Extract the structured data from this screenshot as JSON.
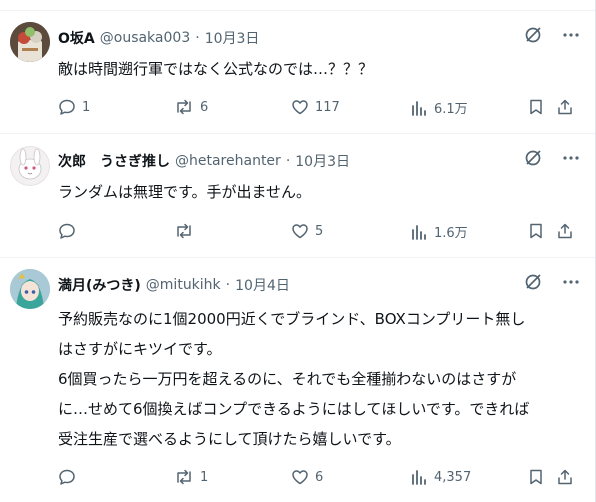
{
  "tweets": [
    {
      "name": "O坂A",
      "handle": "@ousaka003",
      "date": "10月3日",
      "lines": [
        "敵は時間遡行軍ではなく公式なのでは…？？？"
      ],
      "replies": "1",
      "reposts": "6",
      "likes": "117",
      "views": "6.1万"
    },
    {
      "name": "次郎　うさぎ推し",
      "handle": "@hetarehanter",
      "date": "10月3日",
      "lines": [
        "ランダムは無理です。手が出ません。"
      ],
      "replies": "",
      "reposts": "",
      "likes": "5",
      "views": "1.6万"
    },
    {
      "name": "満月(みつき)",
      "handle": "@mitukihk",
      "date": "10月4日",
      "lines": [
        "予約販売なのに1個2000円近くでブラインド、BOXコンプリート無し",
        "はさすがにキツイです。",
        "6個買ったら一万円を超えるのに、それでも全種揃わないのはさすが",
        "に…せめて6個換えばコンプできるようにはしてほしいです。できれば",
        "受注生産で選べるようにして頂けたら嬉しいです。"
      ],
      "replies": "",
      "reposts": "1",
      "likes": "6",
      "views": "4,357"
    }
  ],
  "icons": [
    "grok-icon",
    "more-icon",
    "reply-icon",
    "repost-icon",
    "like-icon",
    "views-icon",
    "bookmark-icon",
    "share-icon"
  ],
  "colors": {
    "text": "#0f1419",
    "secondary": "#536471",
    "divider": "#eff3f4"
  }
}
